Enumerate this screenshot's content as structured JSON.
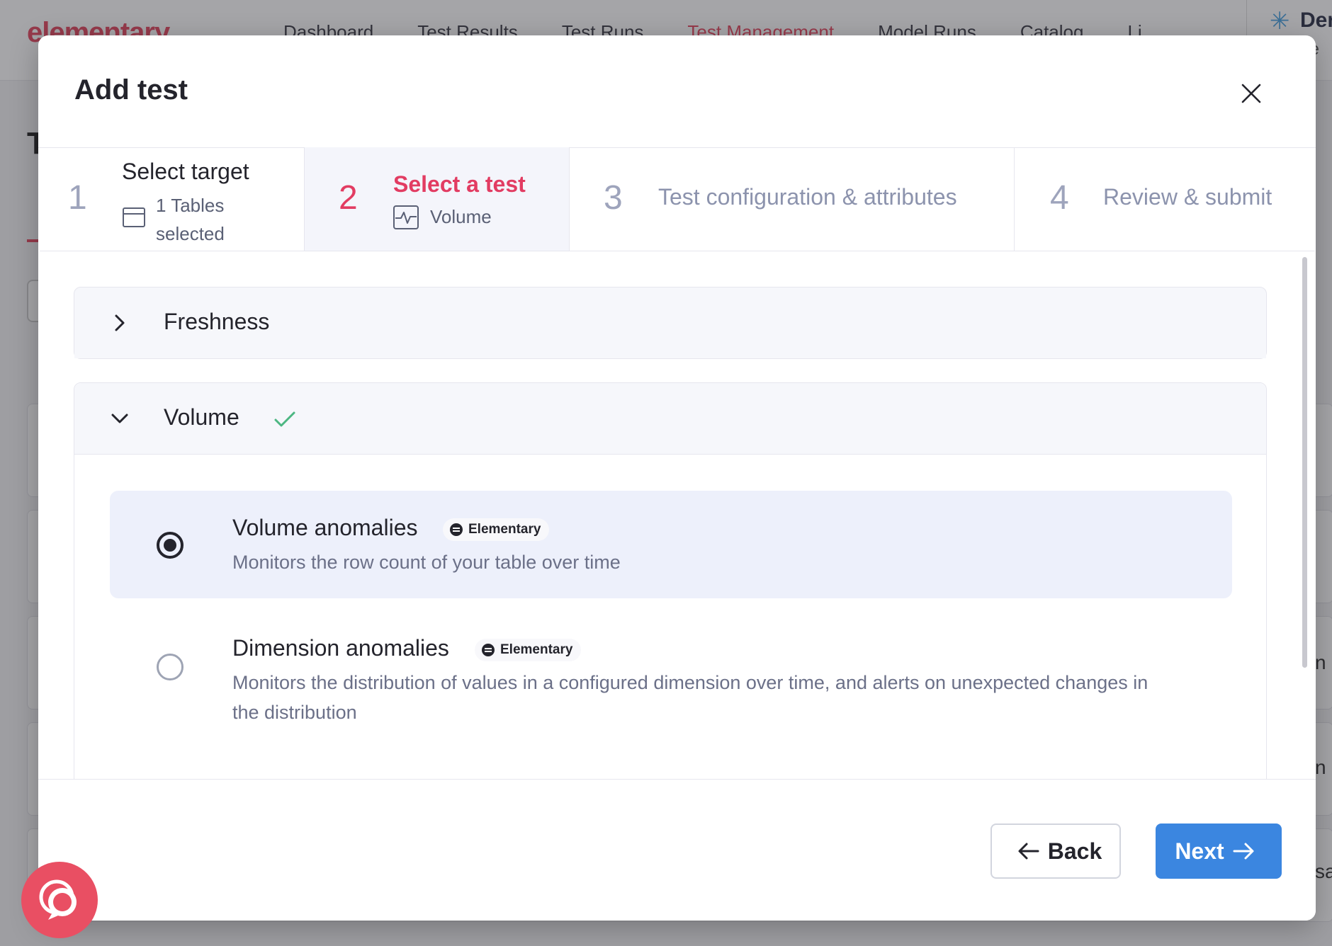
{
  "background": {
    "logo": "elementary",
    "nav": [
      "Dashboard",
      "Test Results",
      "Test Runs",
      "Test Management",
      "Model Runs",
      "Catalog",
      "Li"
    ],
    "active_nav": "Test Management",
    "account_name": "Der",
    "account_sub": "te",
    "page_title_initial": "T",
    "side_text": [
      "n",
      "n",
      "sa"
    ]
  },
  "modal": {
    "title": "Add test",
    "steps": [
      {
        "num": "1",
        "label": "Select target",
        "sub": "1 Tables selected",
        "state": "done"
      },
      {
        "num": "2",
        "label": "Select a test",
        "sub": "Volume",
        "state": "active"
      },
      {
        "num": "3",
        "label": "Test configuration & attributes",
        "state": "pending"
      },
      {
        "num": "4",
        "label": "Review & submit",
        "state": "pending"
      }
    ],
    "sections": [
      {
        "title": "Freshness",
        "expanded": false
      },
      {
        "title": "Volume",
        "expanded": true,
        "selected": true
      }
    ],
    "options": [
      {
        "title": "Volume anomalies",
        "badge": "Elementary",
        "description": "Monitors the row count of your table over time",
        "checked": true
      },
      {
        "title": "Dimension anomalies",
        "badge": "Elementary",
        "description": "Monitors the distribution of values in a configured dimension over time, and alerts on unexpected changes in the distribution",
        "checked": false
      }
    ],
    "back_label": "Back",
    "next_label": "Next"
  },
  "colors": {
    "accent": "#e23c62",
    "primary_button": "#3b86e0",
    "success_check": "#4cb782",
    "chat_bubble": "#e94f63"
  }
}
